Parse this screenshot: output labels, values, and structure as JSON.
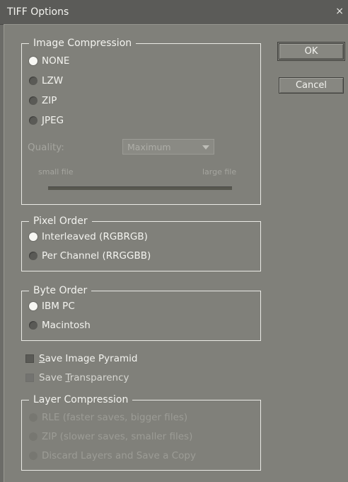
{
  "window": {
    "title": "TIFF Options",
    "close_glyph": "×"
  },
  "buttons": {
    "ok": "OK",
    "cancel": "Cancel"
  },
  "image_compression": {
    "legend": "Image Compression",
    "options": [
      "NONE",
      "LZW",
      "ZIP",
      "JPEG"
    ],
    "selected": "NONE",
    "quality_label": "Quality:",
    "quality_value": "Maximum",
    "small_file": "small file",
    "large_file": "large file"
  },
  "pixel_order": {
    "legend": "Pixel Order",
    "options": [
      "Interleaved (RGBRGB)",
      "Per Channel (RRGGBB)"
    ],
    "selected": "Interleaved (RGBRGB)"
  },
  "byte_order": {
    "legend": "Byte Order",
    "options": [
      "IBM PC",
      "Macintosh"
    ],
    "selected": "IBM PC"
  },
  "checkboxes": {
    "save_image_pyramid": {
      "prefix": "",
      "underlined": "S",
      "rest": "ave Image Pyramid"
    },
    "save_transparency": {
      "prefix": "Save ",
      "underlined": "T",
      "rest": "ransparency"
    }
  },
  "layer_compression": {
    "legend": "Layer Compression",
    "options": [
      "RLE (faster saves, bigger files)",
      "ZIP (slower saves, smaller files)",
      "Discard Layers and Save a Copy"
    ]
  }
}
